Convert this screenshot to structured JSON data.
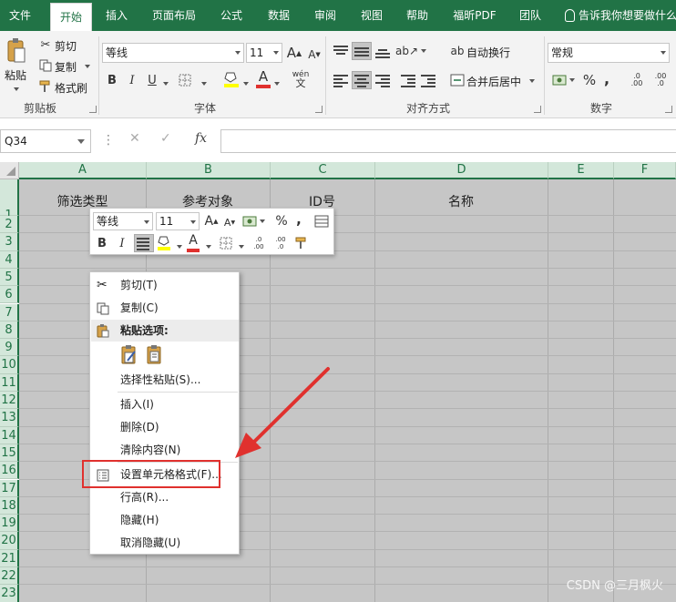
{
  "tabs": [
    "文件",
    "开始",
    "插入",
    "页面布局",
    "公式",
    "数据",
    "审阅",
    "视图",
    "帮助",
    "福昕PDF",
    "团队"
  ],
  "tell_me": "告诉我你想要做什么",
  "clipboard": {
    "paste": "粘贴",
    "cut": "剪切",
    "copy": "复制",
    "format_painter": "格式刷",
    "label": "剪贴板"
  },
  "font": {
    "name": "等线",
    "size": "11",
    "label": "字体",
    "bold": "B",
    "italic": "I",
    "underline": "U",
    "grow": "A",
    "shrink": "A",
    "color_letter": "A",
    "wen": "wén"
  },
  "alignment": {
    "wrap": "自动换行",
    "merge": "合并后居中",
    "label": "对齐方式"
  },
  "number": {
    "format": "常规",
    "label": "数字",
    "percent": "%",
    "comma": ",",
    "inc": ".00",
    "dec": ".0"
  },
  "namebox": "Q34",
  "fx": "fx",
  "columns": [
    "A",
    "B",
    "C",
    "D",
    "E",
    "F"
  ],
  "rows": [
    "1",
    "2",
    "3",
    "4",
    "5",
    "6",
    "7",
    "8",
    "9",
    "10",
    "11",
    "12",
    "13",
    "14",
    "15",
    "16",
    "17",
    "18",
    "19",
    "20",
    "21",
    "22",
    "23"
  ],
  "header_cells": {
    "a1": "筛选类型",
    "b1": "参考对象",
    "c1": "ID号",
    "d1": "名称"
  },
  "mini_toolbar": {
    "font": "等线",
    "size": "11",
    "percent": "%",
    "comma": ",",
    "bold": "B",
    "italic": "I",
    "color_letter": "A"
  },
  "context_menu": {
    "cut": "剪切(T)",
    "copy": "复制(C)",
    "paste_options": "粘贴选项:",
    "paste_special": "选择性粘贴(S)...",
    "insert": "插入(I)",
    "delete": "删除(D)",
    "clear": "清除内容(N)",
    "format_cells": "设置单元格格式(F)...",
    "row_height": "行高(R)...",
    "hide": "隐藏(H)",
    "unhide": "取消隐藏(U)"
  },
  "watermark": "CSDN @三月枫火",
  "colors": {
    "excel_green": "#217346",
    "highlight_red": "#e0312e",
    "grid_gray": "#c6c6c6"
  }
}
